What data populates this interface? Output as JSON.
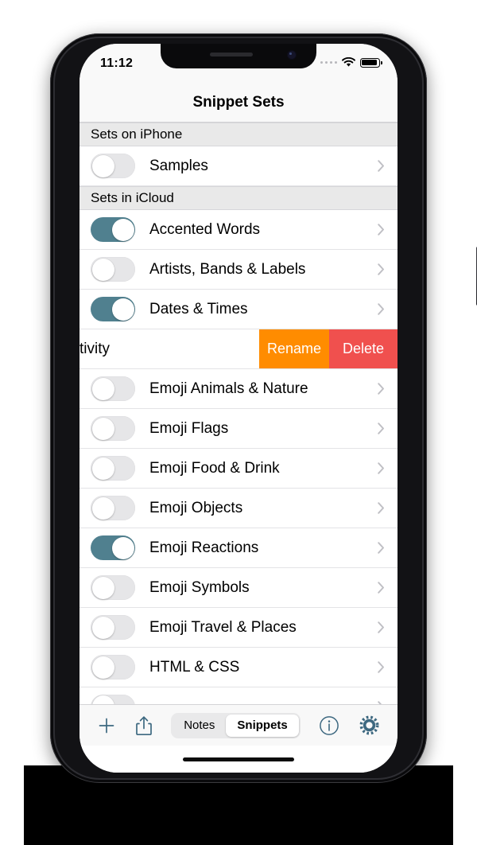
{
  "status_bar": {
    "time": "11:12",
    "cellular_icon": "cellular-dots-icon",
    "wifi_icon": "wifi-icon",
    "battery_icon": "battery-icon"
  },
  "navbar": {
    "title": "Snippet Sets"
  },
  "colors": {
    "toggle_on": "#50808f",
    "toggle_off_track": "#e6e6e8",
    "rename_action": "#FF8C00",
    "delete_action": "#F0504E",
    "toolbar_icon": "#3d6880",
    "section_header_bg": "#e9e9e9"
  },
  "sections": [
    {
      "header": "Sets on iPhone",
      "rows": [
        {
          "label": "Samples",
          "enabled": false,
          "disclosure": "chevron-right-icon"
        }
      ]
    },
    {
      "header": "Sets in iCloud",
      "rows": [
        {
          "label": "Accented Words",
          "enabled": true,
          "disclosure": "chevron-right-icon"
        },
        {
          "label": "Artists, Bands & Labels",
          "enabled": false,
          "disclosure": "chevron-right-icon"
        },
        {
          "label": "Dates & Times",
          "enabled": true,
          "disclosure": "chevron-right-icon"
        },
        {
          "label": "tivity",
          "enabled": false,
          "disclosure": "chevron-right-icon",
          "swiped": true
        },
        {
          "label": "Emoji Animals & Nature",
          "enabled": false,
          "disclosure": "chevron-right-icon"
        },
        {
          "label": "Emoji Flags",
          "enabled": false,
          "disclosure": "chevron-right-icon"
        },
        {
          "label": "Emoji Food & Drink",
          "enabled": false,
          "disclosure": "chevron-right-icon"
        },
        {
          "label": "Emoji Objects",
          "enabled": false,
          "disclosure": "chevron-right-icon"
        },
        {
          "label": "Emoji Reactions",
          "enabled": true,
          "disclosure": "chevron-right-icon"
        },
        {
          "label": "Emoji Symbols",
          "enabled": false,
          "disclosure": "chevron-right-icon"
        },
        {
          "label": "Emoji Travel & Places",
          "enabled": false,
          "disclosure": "chevron-right-icon"
        },
        {
          "label": "HTML & CSS",
          "enabled": false,
          "disclosure": "chevron-right-icon"
        },
        {
          "label": "",
          "enabled": false,
          "disclosure": "chevron-right-icon",
          "partial": true
        }
      ]
    }
  ],
  "swipe_actions": {
    "rename_label": "Rename",
    "delete_label": "Delete"
  },
  "toolbar": {
    "add_icon": "plus-icon",
    "share_icon": "share-icon",
    "info_icon": "info-circle-icon",
    "settings_icon": "gear-icon",
    "segments": [
      {
        "label": "Notes",
        "selected": false
      },
      {
        "label": "Snippets",
        "selected": true
      }
    ]
  }
}
